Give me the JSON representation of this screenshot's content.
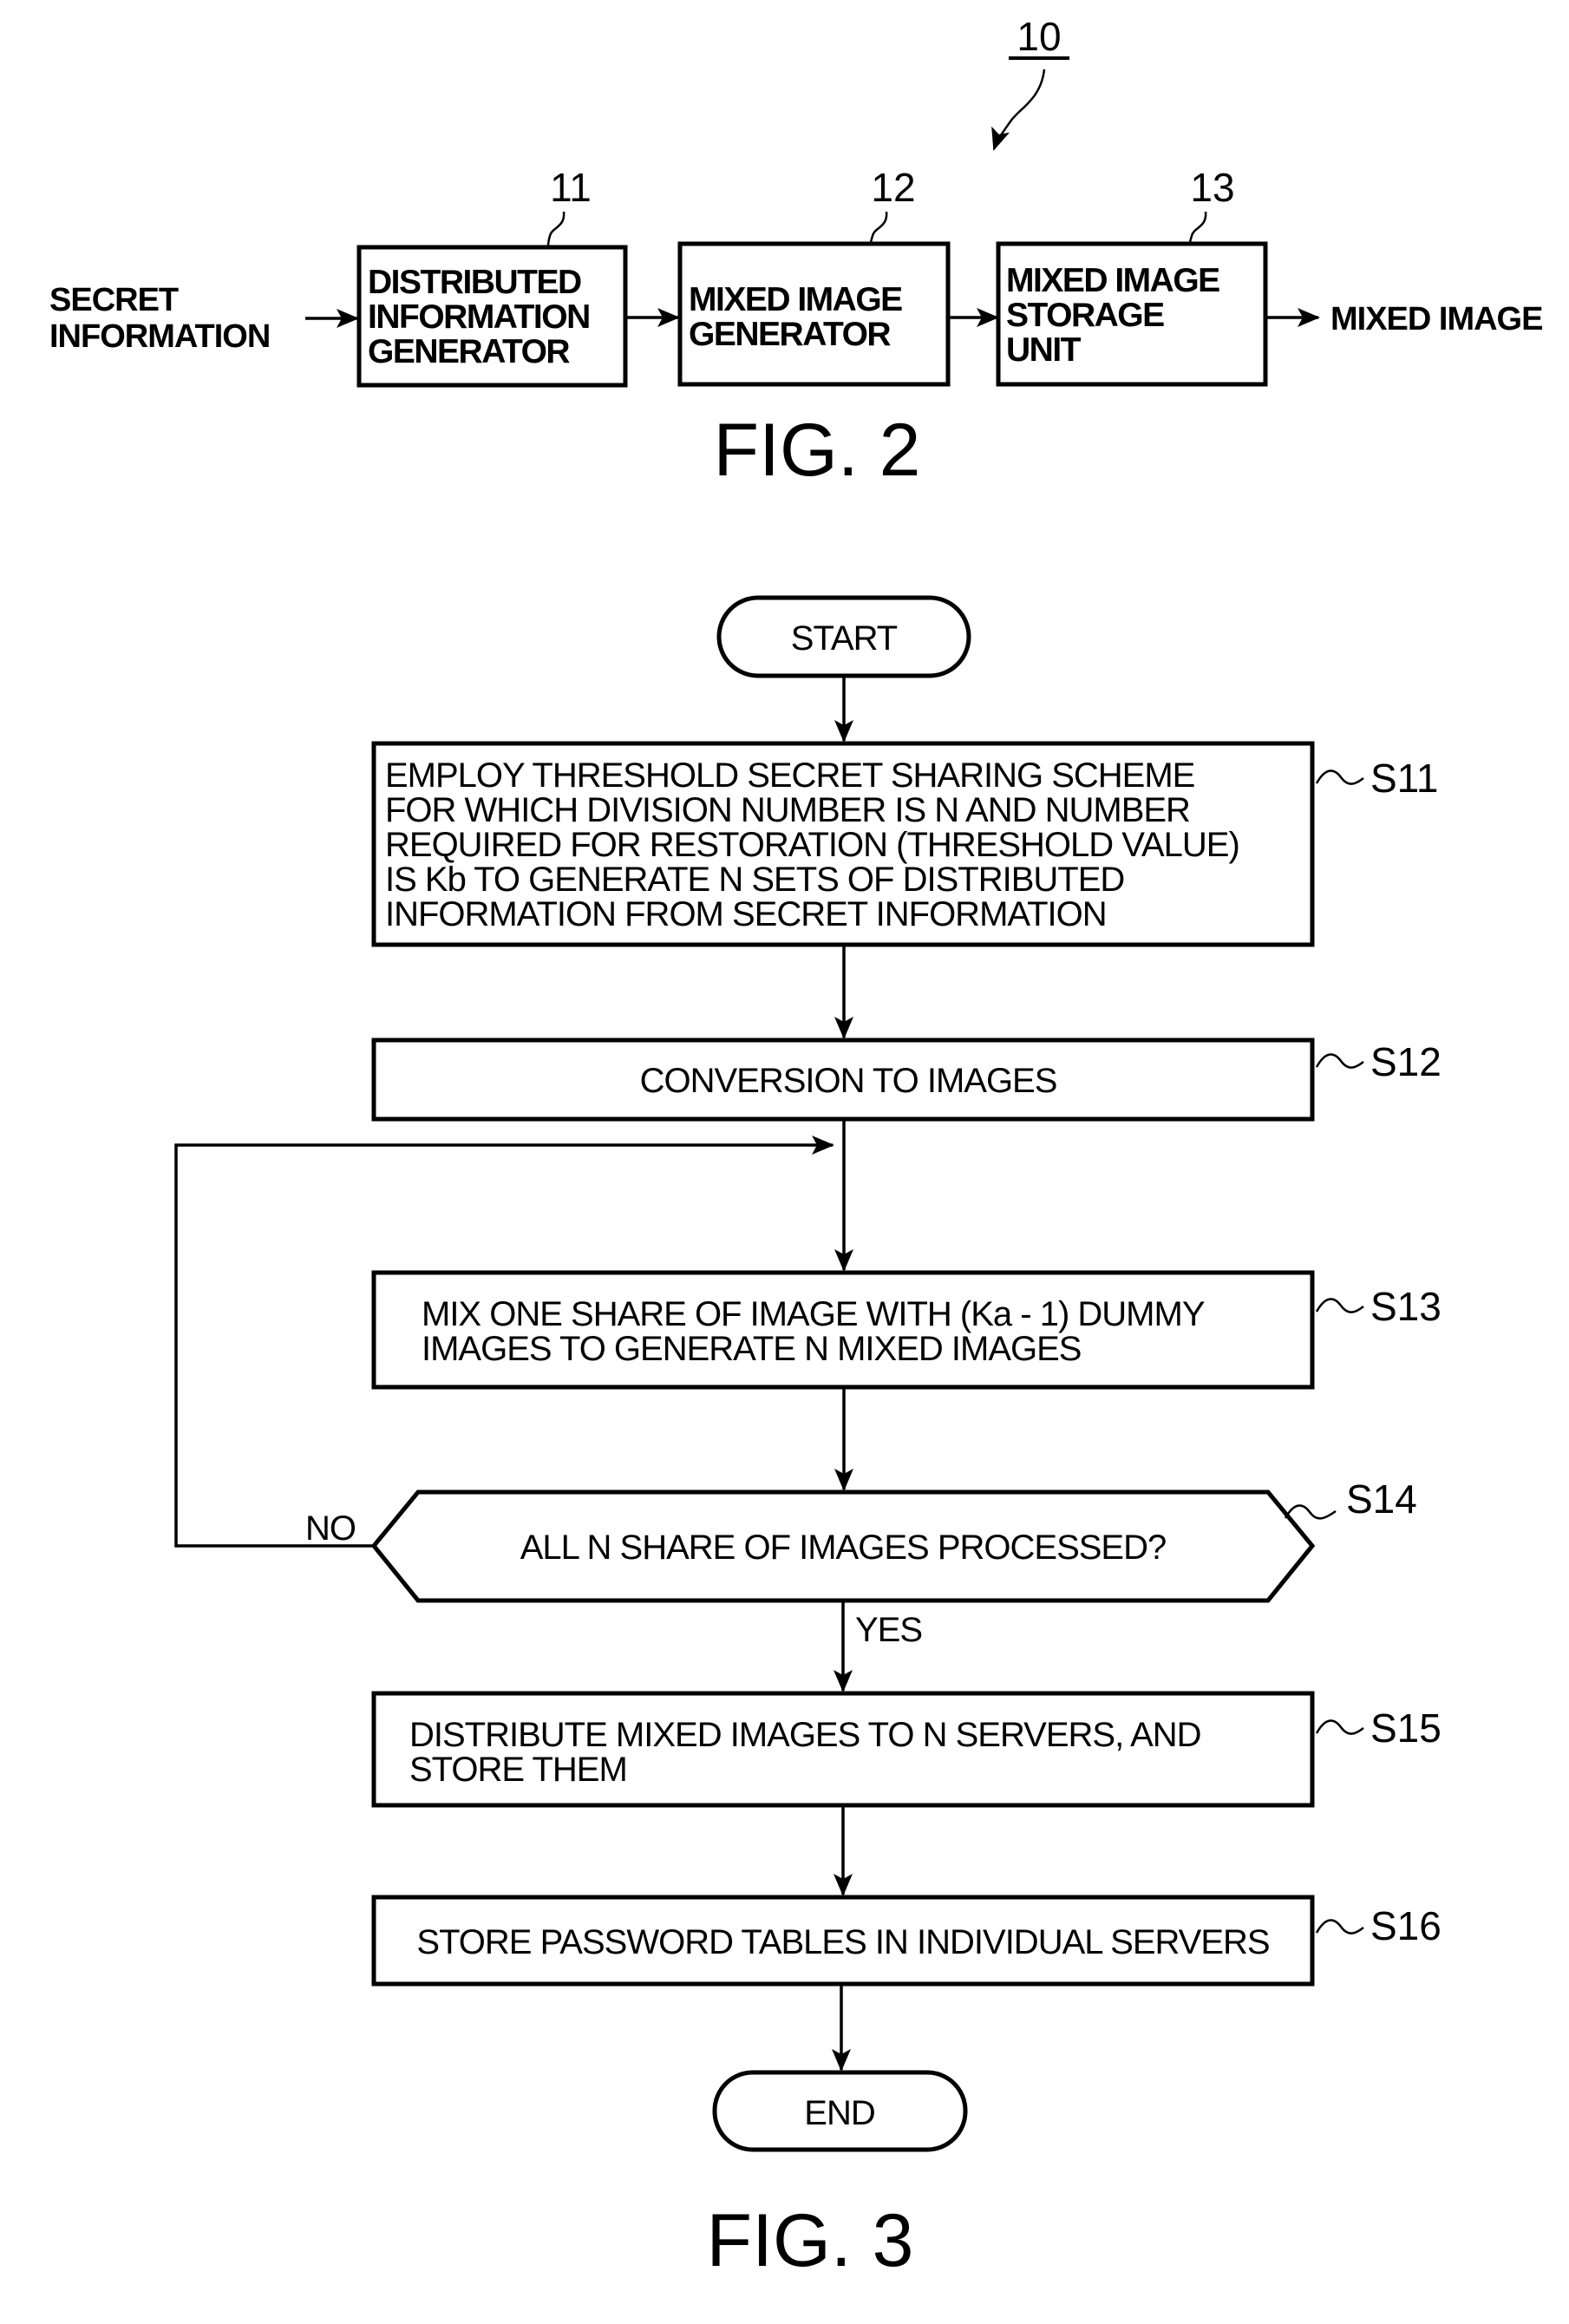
{
  "fig2": {
    "assembly_ref": "10",
    "input_label": [
      "SECRET",
      "INFORMATION"
    ],
    "output_label": "MIXED IMAGE",
    "blocks": [
      {
        "ref": "11",
        "lines": [
          "DISTRIBUTED",
          "INFORMATION",
          "GENERATOR"
        ]
      },
      {
        "ref": "12",
        "lines": [
          "MIXED IMAGE",
          "GENERATOR"
        ]
      },
      {
        "ref": "13",
        "lines": [
          "MIXED IMAGE",
          "STORAGE",
          "UNIT"
        ]
      }
    ],
    "caption": "FIG. 2"
  },
  "fig3": {
    "start": "START",
    "end": "END",
    "steps": [
      {
        "id": "S11",
        "lines": [
          "EMPLOY THRESHOLD SECRET SHARING SCHEME",
          "FOR WHICH DIVISION NUMBER IS N AND NUMBER",
          "REQUIRED FOR RESTORATION (THRESHOLD VALUE)",
          "IS Kb TO GENERATE N SETS OF DISTRIBUTED",
          "INFORMATION FROM SECRET INFORMATION"
        ]
      },
      {
        "id": "S12",
        "lines": [
          "CONVERSION TO IMAGES"
        ]
      },
      {
        "id": "S13",
        "lines": [
          "MIX ONE SHARE OF IMAGE WITH (Ka - 1) DUMMY",
          "IMAGES TO GENERATE N MIXED IMAGES"
        ]
      },
      {
        "id": "S14",
        "lines": [
          "ALL N SHARE OF IMAGES PROCESSED?"
        ]
      },
      {
        "id": "S15",
        "lines": [
          "DISTRIBUTE MIXED IMAGES TO N SERVERS, AND",
          "STORE THEM"
        ]
      },
      {
        "id": "S16",
        "lines": [
          "STORE PASSWORD TABLES IN INDIVIDUAL SERVERS"
        ]
      }
    ],
    "decision_no": "NO",
    "decision_yes": "YES",
    "caption": "FIG. 3"
  }
}
